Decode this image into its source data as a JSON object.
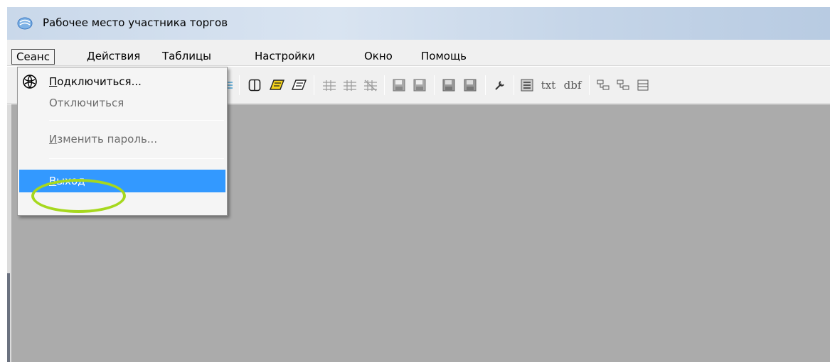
{
  "window": {
    "title": "Рабочее место участника торгов"
  },
  "menubar": {
    "items": [
      "Сеанс",
      "Действия",
      "Таблицы",
      "Настройки",
      "Окно",
      "Помощь"
    ],
    "active_index": 0
  },
  "session_menu": {
    "connect": "Подключиться...",
    "disconnect": "Отключиться",
    "change_password": "Изменить пароль...",
    "exit": "Выход"
  },
  "toolbar": {
    "export_txt": "txt",
    "export_dbf": "dbf"
  },
  "colors": {
    "highlight": "#3399ff",
    "workspace": "#ababab",
    "annotation_ring": "#a6d81e"
  },
  "icons": [
    "app-logo-icon",
    "connect-globe-icon",
    "window-icon",
    "yellow-book-icon",
    "book-icon",
    "table-icon",
    "floppy-icon",
    "tool-icon",
    "export-icon",
    "tree-icon"
  ]
}
